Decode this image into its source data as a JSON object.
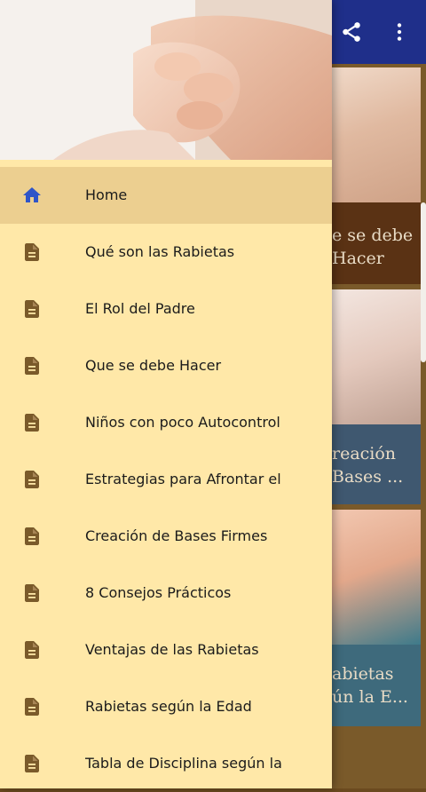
{
  "toolbar": {
    "share_icon": "share-icon",
    "more_icon": "more-vert-icon"
  },
  "background_cards": [
    {
      "caption_line1": "e se debe",
      "caption_line2": "Hacer"
    },
    {
      "caption_line1": "reación",
      "caption_line2": "Bases ..."
    },
    {
      "caption_line1": "abietas",
      "caption_line2": "ún la E..."
    }
  ],
  "drawer": {
    "items": [
      {
        "label": "Home",
        "icon": "home-icon",
        "active": true
      },
      {
        "label": "Qué son las Rabietas",
        "icon": "document-icon"
      },
      {
        "label": "El Rol del Padre",
        "icon": "document-icon"
      },
      {
        "label": "Que se debe Hacer",
        "icon": "document-icon"
      },
      {
        "label": "Niños con poco Autocontrol",
        "icon": "document-icon"
      },
      {
        "label": "Estrategias para Afrontar el",
        "icon": "document-icon"
      },
      {
        "label": "Creación de Bases Firmes",
        "icon": "document-icon"
      },
      {
        "label": "8 Consejos Prácticos",
        "icon": "document-icon"
      },
      {
        "label": "Ventajas de las Rabietas",
        "icon": "document-icon"
      },
      {
        "label": "Rabietas según la Edad",
        "icon": "document-icon"
      },
      {
        "label": "Tabla de Disciplina según la",
        "icon": "document-icon"
      }
    ]
  },
  "colors": {
    "toolbar": "#1f2f8a",
    "drawer_bg": "#ffe8a8",
    "active_bg": "#eccf90",
    "doc_icon": "#7a5a2a",
    "home_icon": "#2f55c8"
  }
}
